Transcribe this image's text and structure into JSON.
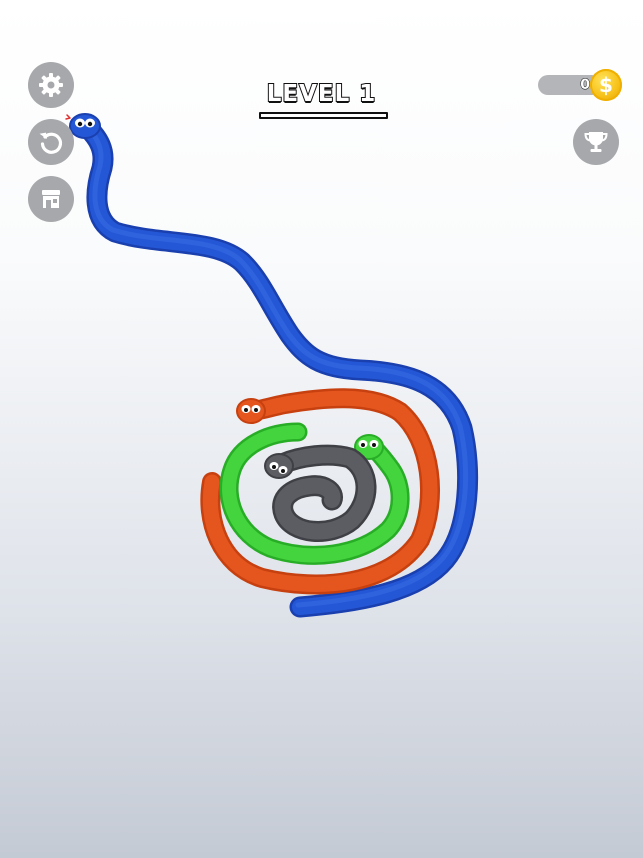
{
  "hud": {
    "level_label": "LEVEL 1",
    "coins": "0",
    "coin_symbol": "$"
  },
  "buttons": [
    {
      "id": "settings",
      "icon": "gear-icon"
    },
    {
      "id": "restart",
      "icon": "restart-icon"
    },
    {
      "id": "shop",
      "icon": "shop-icon"
    },
    {
      "id": "trophy",
      "icon": "trophy-icon"
    }
  ],
  "snakes": [
    {
      "name": "blue-snake",
      "color": "#1f4fc9"
    },
    {
      "name": "orange-snake",
      "color": "#e2541d"
    },
    {
      "name": "green-snake",
      "color": "#3fd63a"
    },
    {
      "name": "gray-snake",
      "color": "#5b5c61"
    }
  ]
}
